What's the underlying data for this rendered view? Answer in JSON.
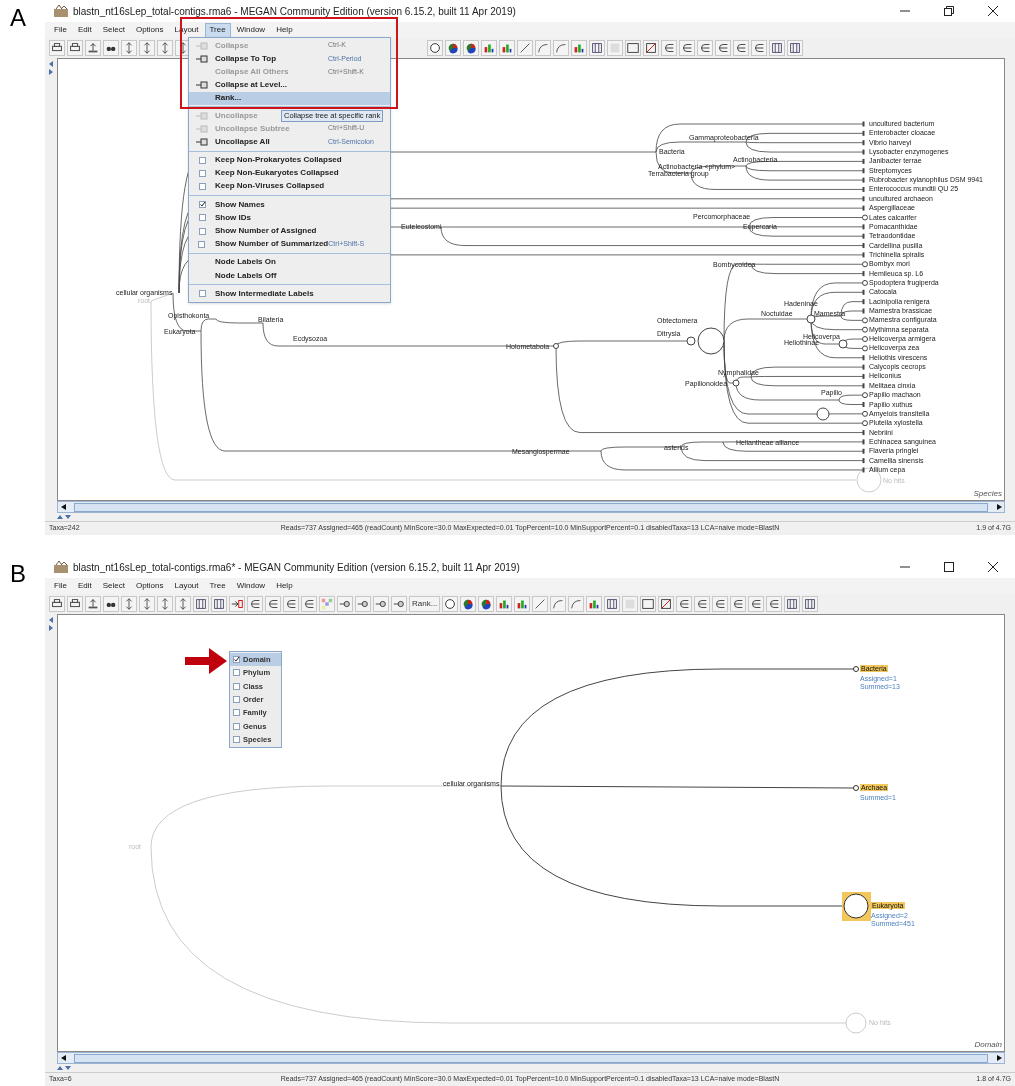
{
  "panels": [
    {
      "letter": "A",
      "window": {
        "title": "blastn_nt16sLep_total-contigs.rma6 - MEGAN Community Edition (version 6.15.2, built 11 Apr 2019)",
        "maximized": true
      },
      "menu_bar": [
        {
          "label": "File",
          "selected": false
        },
        {
          "label": "Edit",
          "selected": false
        },
        {
          "label": "Select",
          "selected": false
        },
        {
          "label": "Options",
          "selected": false
        },
        {
          "label": "Layout",
          "selected": false
        },
        {
          "label": "Tree",
          "selected": true
        },
        {
          "label": "Window",
          "selected": false
        },
        {
          "label": "Help",
          "selected": false
        }
      ],
      "tree_menu": [
        [
          {
            "kind": "command",
            "label": "Collapse",
            "shortcut": "Ctrl-K",
            "disabled": true,
            "selected": false
          },
          {
            "kind": "command",
            "label": "Collapse To Top",
            "shortcut": "Ctrl-Period",
            "disabled": false,
            "selected": false
          },
          {
            "kind": "plain",
            "label": "Collapse All Others",
            "shortcut": "Ctrl+Shift-K",
            "disabled": true,
            "selected": false
          },
          {
            "kind": "command",
            "label": "Collapse at Level...",
            "disabled": false,
            "selected": false
          },
          {
            "kind": "plain",
            "label": "Rank...",
            "disabled": false,
            "selected": true
          }
        ],
        [
          {
            "kind": "command",
            "label": "Uncollapse",
            "disabled": true,
            "selected": false
          },
          {
            "kind": "command",
            "label": "Uncollapse Subtree",
            "shortcut": "Ctrl+Shift-U",
            "disabled": true,
            "selected": false
          },
          {
            "kind": "command",
            "label": "Uncollapse All",
            "shortcut": "Ctrl-Semicolon",
            "disabled": false,
            "selected": false
          }
        ],
        [
          {
            "kind": "checkbox",
            "label": "Keep Non-Prokaryotes Collapsed",
            "checked": false,
            "disabled": false,
            "selected": false
          },
          {
            "kind": "checkbox",
            "label": "Keep Non-Eukaryotes Collapsed",
            "checked": false,
            "disabled": false,
            "selected": false
          },
          {
            "kind": "checkbox",
            "label": "Keep Non-Viruses Collapsed",
            "checked": false,
            "disabled": false,
            "selected": false
          }
        ],
        [
          {
            "kind": "checkbox",
            "label": "Show Names",
            "checked": true,
            "disabled": false,
            "selected": false
          },
          {
            "kind": "checkbox",
            "label": "Show IDs",
            "checked": false,
            "disabled": false,
            "selected": false
          },
          {
            "kind": "checkbox",
            "label": "Show Number of Assigned",
            "checked": false,
            "disabled": false,
            "selected": false
          },
          {
            "kind": "checkbox",
            "label": "Show Number of Summarized",
            "shortcut": "Ctrl+Shift-S",
            "checked": false,
            "disabled": false,
            "selected": false
          }
        ],
        [
          {
            "kind": "plain",
            "label": "Node Labels On",
            "disabled": false,
            "selected": false
          },
          {
            "kind": "plain",
            "label": "Node Labels Off",
            "disabled": false,
            "selected": false
          }
        ],
        [
          {
            "kind": "checkbox",
            "label": "Show Intermediate Labels",
            "checked": false,
            "disabled": false,
            "selected": false
          }
        ]
      ],
      "tooltip": "Collapse tree at specific rank",
      "tree": {
        "kind": "full",
        "root": "root",
        "unassigned": "No hits",
        "inner_labels": [
          "Bacteria",
          "Gammaproteobacteria",
          "Actinobacteria <phylum>",
          "Terrabacteria group",
          "Actinobacteria",
          "Percomorphaceae",
          "Eupercaria",
          "Euteleostomi",
          "Bombycoidea",
          "Hadeninae",
          "Noctuidae",
          "Mamestra",
          "Obtectomera",
          "Ditrysia",
          "Helicoverpa",
          "Heliothinae",
          "Nymphalidae",
          "Papilionoidea",
          "Papilio",
          "Holometabola",
          "Opisthokonta",
          "Bilateria",
          "Ecdysozoa",
          "Eukaryota",
          "cellular organisms",
          "Mesangiospermae",
          "asterids",
          "Heliantheae alliance"
        ],
        "leaves": [
          {
            "label": "uncultured bacterium",
            "node_circle": false
          },
          {
            "label": "Enterobacter cloacae",
            "node_circle": false
          },
          {
            "label": "Vibrio harveyi",
            "node_circle": false
          },
          {
            "label": "Lysobacter enzymogenes",
            "node_circle": false
          },
          {
            "label": "Janibacter terrae",
            "node_circle": false
          },
          {
            "label": "Streptomyces",
            "node_circle": false
          },
          {
            "label": "Rubrobacter xylanophilus DSM 9941",
            "node_circle": false
          },
          {
            "label": "Enterococcus mundtii QU 25",
            "node_circle": false
          },
          {
            "label": "uncultured archaeon",
            "node_circle": false
          },
          {
            "label": "Aspergillaceae",
            "node_circle": false
          },
          {
            "label": "Lates calcarifer",
            "node_circle": true
          },
          {
            "label": "Pomacanthidae",
            "node_circle": false
          },
          {
            "label": "Tetraodontidae",
            "node_circle": false
          },
          {
            "label": "Cardellina pusilla",
            "node_circle": false
          },
          {
            "label": "Trichinella spiralis",
            "node_circle": false
          },
          {
            "label": "Bombyx mori",
            "node_circle": true
          },
          {
            "label": "Hemileuca sp. L6",
            "node_circle": false
          },
          {
            "label": "Spodoptera frugiperda",
            "node_circle": true
          },
          {
            "label": "Catocala",
            "node_circle": false
          },
          {
            "label": "Lacinipolia renigera",
            "node_circle": false
          },
          {
            "label": "Mamestra brassicae",
            "node_circle": false
          },
          {
            "label": "Mamestra configurata",
            "node_circle": true
          },
          {
            "label": "Mythimna separata",
            "node_circle": true
          },
          {
            "label": "Helicoverpa armigera",
            "node_circle": true
          },
          {
            "label": "Helicoverpa zea",
            "node_circle": true
          },
          {
            "label": "Heliothis virescens",
            "node_circle": false
          },
          {
            "label": "Calycopis cecrops",
            "node_circle": false
          },
          {
            "label": "Heliconius",
            "node_circle": false
          },
          {
            "label": "Melitaea cinxia",
            "node_circle": false
          },
          {
            "label": "Papilio machaon",
            "node_circle": true
          },
          {
            "label": "Papilio xuthus",
            "node_circle": false
          },
          {
            "label": "Amyelois transitella",
            "node_circle": true
          },
          {
            "label": "Plutella xylostella",
            "node_circle": true
          },
          {
            "label": "Nebriini",
            "node_circle": false
          },
          {
            "label": "Echinacea sanguinea",
            "node_circle": false
          },
          {
            "label": "Flaveria pringlei",
            "node_circle": false
          },
          {
            "label": "Camellia sinensis",
            "node_circle": false
          },
          {
            "label": "Allium cepa",
            "node_circle": false
          }
        ]
      },
      "corner_label": "Species",
      "status_bar": {
        "left": "Taxa=242",
        "center": "Reads=737 Assigned=465 (readCount) MinScore=30.0 MaxExpected=0.01 TopPercent=10.0 MinSupportPercent=0.1 disabledTaxa=13 LCA=naive mode=BlastN",
        "right": "1.9 of 4.7G"
      }
    },
    {
      "letter": "B",
      "window": {
        "title": "blastn_nt16sLep_total-contigs.rma6* - MEGAN Community Edition (version 6.15.2, built 11 Apr 2019)",
        "maximized": false
      },
      "menu_bar": [
        {
          "label": "File",
          "selected": false
        },
        {
          "label": "Edit",
          "selected": false
        },
        {
          "label": "Select",
          "selected": false
        },
        {
          "label": "Options",
          "selected": false
        },
        {
          "label": "Layout",
          "selected": false
        },
        {
          "label": "Tree",
          "selected": false
        },
        {
          "label": "Window",
          "selected": false
        },
        {
          "label": "Help",
          "selected": false
        }
      ],
      "toolbar": {
        "rank_button": "Rank..."
      },
      "rank_popup": [
        {
          "label": "Domain",
          "checked": true,
          "selected": true
        },
        {
          "label": "Phylum",
          "checked": false,
          "selected": false
        },
        {
          "label": "Class",
          "checked": false,
          "selected": false
        },
        {
          "label": "Order",
          "checked": false,
          "selected": false
        },
        {
          "label": "Family",
          "checked": false,
          "selected": false
        },
        {
          "label": "Genus",
          "checked": false,
          "selected": false
        },
        {
          "label": "Species",
          "checked": false,
          "selected": false
        }
      ],
      "tree": {
        "kind": "domain",
        "root": "root",
        "unassigned": "No hits",
        "inner_labels": [
          "cellular organisms"
        ],
        "nodes": [
          {
            "label": "Bacteria",
            "highlighted": true,
            "counts": [
              "Assigned=1",
              "Summed=13"
            ]
          },
          {
            "label": "Archaea",
            "highlighted": true,
            "counts": [
              "Summed=1"
            ]
          },
          {
            "label": "Eukaryota",
            "highlighted": true,
            "counts": [
              "Assigned=2",
              "Summed=451"
            ]
          }
        ]
      },
      "corner_label": "Domain",
      "status_bar": {
        "left": "Taxa=6",
        "center": "Reads=737 Assigned=465 (readCount) MinScore=30.0 MaxExpected=0.01 TopPercent=10.0 MinSupportPercent=0.1 disabledTaxa=13 LCA=naive mode=BlastN",
        "right": "1.8 of 4.7G"
      }
    }
  ]
}
